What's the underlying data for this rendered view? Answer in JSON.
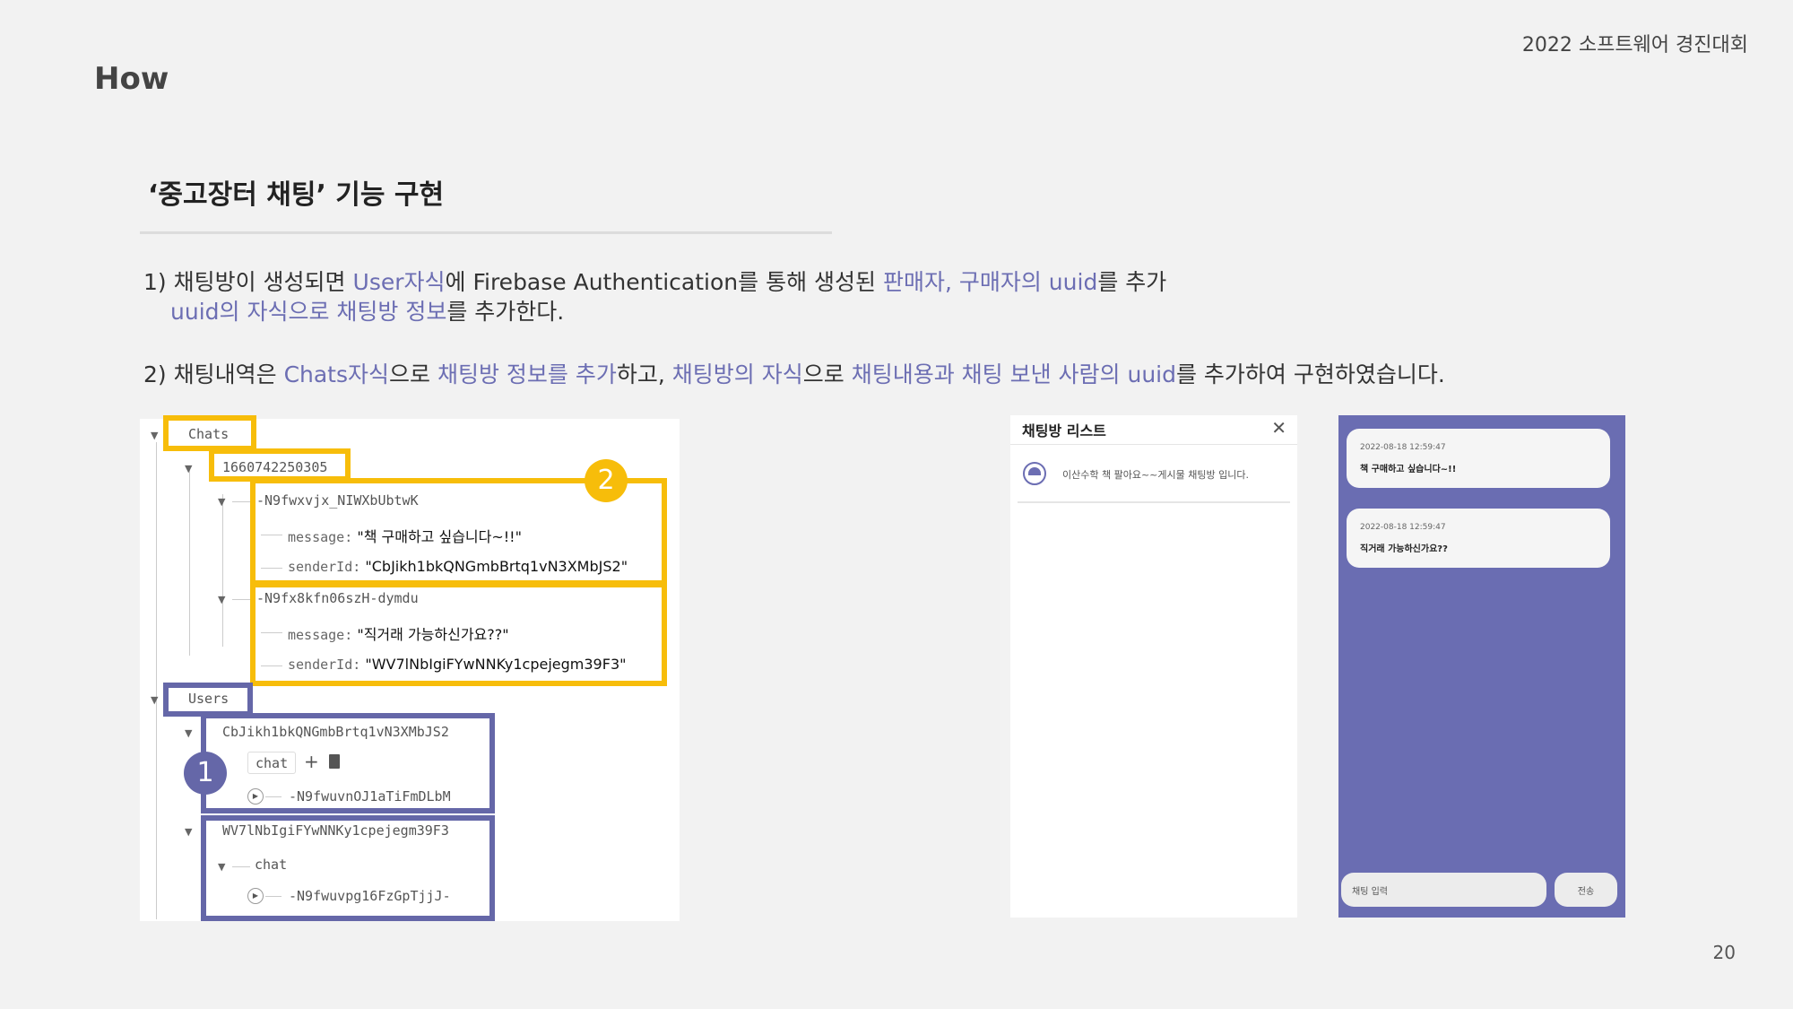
{
  "header": {
    "event": "2022 소프트웨어 경진대회",
    "title": "How",
    "page_number": "20"
  },
  "section": {
    "title": "‘중고장터 채팅’ 기능 구현"
  },
  "para1": {
    "a1": "1) 채팅방이 생성되면 ",
    "a2": "User자식",
    "a3": "에 Firebase Authentication를 통해  생성된 ",
    "a4": "판매자, 구매자의 uuid",
    "a5": "를 추가",
    "b1": "uuid의 자식으로 채팅방 정보",
    "b2": "를 추가한다."
  },
  "para2": {
    "t1": "2) 채팅내역은 ",
    "t2": "Chats자식",
    "t3": "으로 ",
    "t4": "채팅방 정보를 추가",
    "t5": "하고, ",
    "t6": "채팅방의 자식",
    "t7": "으로 ",
    "t8": "채팅내용과 채팅 보낸 사람의  uuid",
    "t9": "를 추가하여 구현하였습니다."
  },
  "tree": {
    "chats": "Chats",
    "room": "1660742250305",
    "msg1": {
      "id": "-N9fwxvjx_NIWXbUbtwK",
      "message_key": "message:",
      "message": "\"책 구매하고 싶습니다~!!\"",
      "sender_key": "senderId:",
      "sender": "\"CbJikh1bkQNGmbBrtq1vN3XMbJS2\""
    },
    "msg2": {
      "id": "-N9fx8kfn06szH-dymdu",
      "message_key": "message:",
      "message": "\"직거래 가능하신가요??\"",
      "sender_key": "senderId:",
      "sender": "\"WV7lNbIgiFYwNNKy1cpejegm39F3\""
    },
    "users": "Users",
    "user1": {
      "id": "CbJikh1bkQNGmbBrtq1vN3XMbJS2",
      "chat": "chat",
      "room": "-N9fwuvnOJ1aTiFmDLbM"
    },
    "user2": {
      "id": "WV7lNbIgiFYwNNKy1cpejegm39F3",
      "chat": "chat",
      "room": "-N9fwuvpg16FzGpTjjJ-"
    },
    "badge1": "1",
    "badge2": "2"
  },
  "chat_list": {
    "title": "채팅방 리스트",
    "item": "이산수학 책 팔아요~~게시물 채팅방 입니다."
  },
  "chat_room": {
    "messages": [
      {
        "time": "2022-08-18 12:59:47",
        "text": "책 구매하고 싶습니다~!!"
      },
      {
        "time": "2022-08-18 12:59:47",
        "text": "직거래 가능하신가요??"
      }
    ],
    "input_placeholder": "채팅 입력",
    "send_label": "전송"
  },
  "colors": {
    "highlight": "#6c6eb3",
    "yellow_box": "#f7bd0a",
    "purple_box": "#6567a8",
    "chat_bg": "#6a6db2"
  }
}
